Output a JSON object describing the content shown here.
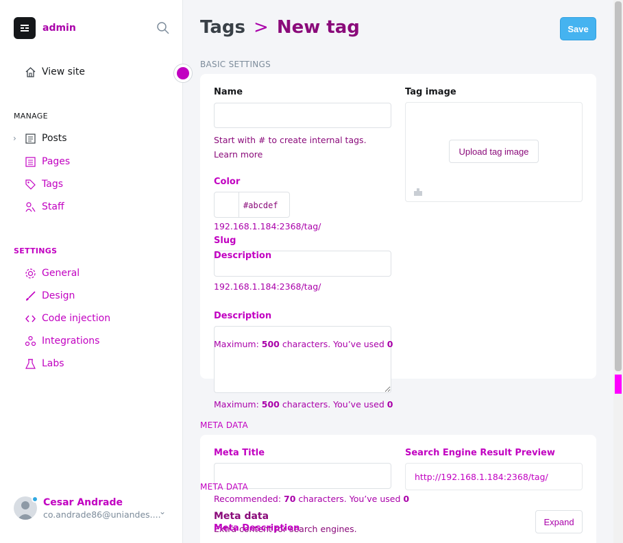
{
  "sidebar": {
    "brand_name": "admin",
    "view_site": "View site",
    "manage_title": "MANAGE",
    "manage_items": [
      {
        "label": "Posts",
        "icon": "posts-icon"
      },
      {
        "label": "Pages",
        "icon": "pages-icon"
      },
      {
        "label": "Tags",
        "icon": "tag-icon"
      },
      {
        "label": "Staff",
        "icon": "staff-icon"
      }
    ],
    "settings_title": "SETTINGS",
    "settings_items": [
      {
        "label": "General",
        "icon": "gear-icon"
      },
      {
        "label": "Design",
        "icon": "brush-icon"
      },
      {
        "label": "Code injection",
        "icon": "code-icon"
      },
      {
        "label": "Integrations",
        "icon": "integrations-icon"
      },
      {
        "label": "Labs",
        "icon": "flask-icon"
      }
    ],
    "user": {
      "name": "Cesar Andrade",
      "email": "co.andrade86@uniandes...."
    }
  },
  "header": {
    "breadcrumb_parent": "Tags",
    "breadcrumb_separator": ">",
    "breadcrumb_current": "New tag",
    "save_label": "Save"
  },
  "basic": {
    "group_label": "BASIC SETTINGS",
    "name_label": "Name",
    "name_value": "",
    "name_hint": "Start with # to create internal tags. Learn more",
    "color_label": "Color",
    "color_value": "#abcdef",
    "url_preview_1": "192.168.1.184:2368/tag/",
    "slug_label": "Slug",
    "slug_overlay_label": "Description",
    "slug_value": "",
    "url_preview_2": "192.168.1.184:2368/tag/",
    "description_label": "Description",
    "desc_hint_prefix": "Maximum: ",
    "desc_hint_max": "500",
    "desc_hint_mid": " characters. You’ve used ",
    "desc_hint_used": "0",
    "tag_image_label": "Tag image",
    "upload_label": "Upload tag image"
  },
  "meta": {
    "group_label": "META DATA",
    "meta_title_label": "Meta Title",
    "meta_title_value": "",
    "meta_title_hint_prefix": "Recommended: ",
    "meta_title_hint_max": "70",
    "meta_title_hint_mid": " characters. You’ve used ",
    "meta_title_hint_used": "0",
    "overlay_group_label": "META DATA",
    "overlay_heading": "Meta data",
    "overlay_sub": "Extra content for search engines.",
    "meta_description_label": "Meta Description",
    "serp_label": "Search Engine Result Preview",
    "serp_url": "http://192.168.1.184:2368/tag/",
    "expand_label": "Expand"
  },
  "colors": {
    "accent": "#45b3f0",
    "highlight": "#c100c1",
    "text": "#15171a"
  }
}
